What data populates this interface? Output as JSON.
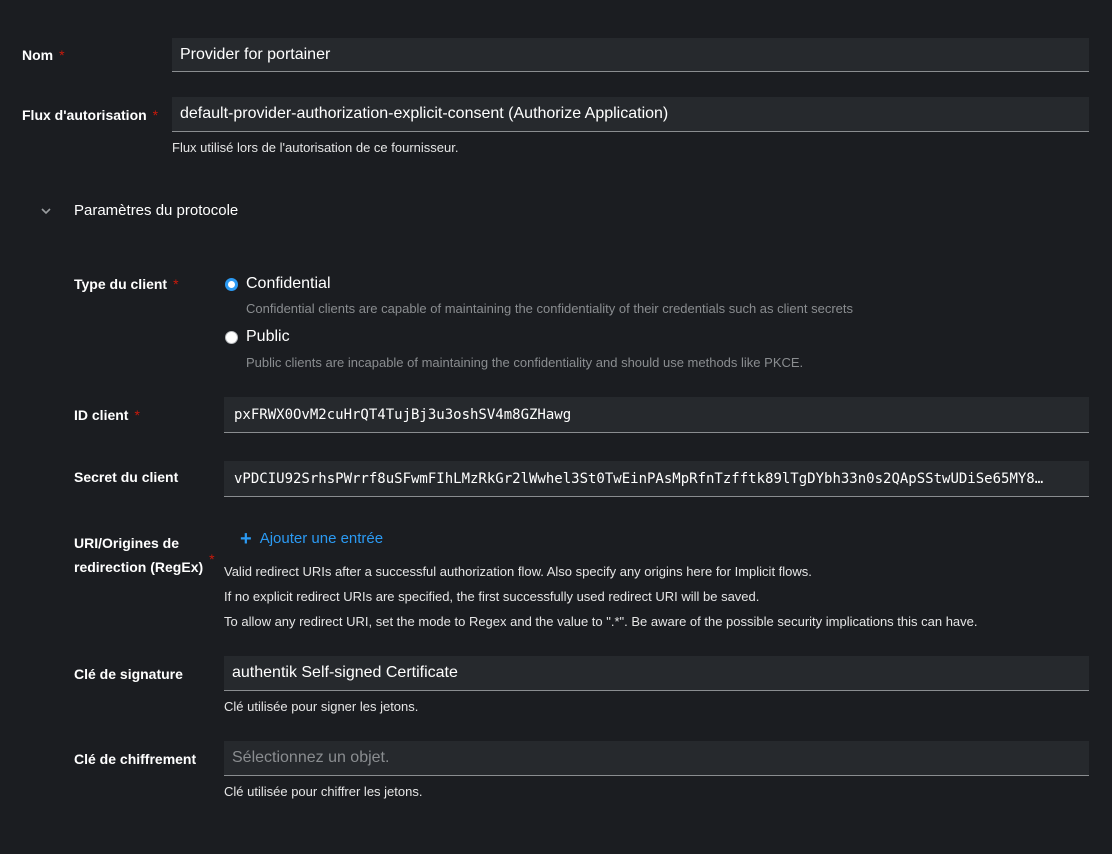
{
  "fields": {
    "name": {
      "label": "Nom",
      "required": "*",
      "value": "Provider for portainer"
    },
    "flow": {
      "label": "Flux d'autorisation",
      "required": "*",
      "value": "default-provider-authorization-explicit-consent (Authorize Application)",
      "help": "Flux utilisé lors de l'autorisation de ce fournisseur."
    }
  },
  "protocol": {
    "section_title": "Paramètres du protocole",
    "client_type": {
      "label": "Type du client",
      "required": "*",
      "options": [
        {
          "label": "Confidential",
          "description": "Confidential clients are capable of maintaining the confidentiality of their credentials such as client secrets",
          "checked": true
        },
        {
          "label": "Public",
          "description": "Public clients are incapable of maintaining the confidentiality and should use methods like PKCE.",
          "checked": false
        }
      ]
    },
    "client_id": {
      "label": "ID client",
      "required": "*",
      "value": "pxFRWX0OvM2cuHrQT4TujBj3u3oshSV4m8GZHawg"
    },
    "client_secret": {
      "label": "Secret du client",
      "value": "vPDCIU92SrhsPWrrf8uSFwmFIhLMzRkGr2lWwhel3St0TwEinPAsMpRfnTzfftk89lTgDYbh33n0s2QApSStwUDiSe65MY8…"
    },
    "redirect": {
      "label_line1": "URI/Origines de",
      "label_line2": "redirection (RegEx)",
      "required": "*",
      "add_label": "Ajouter une entrée",
      "help_lines": [
        "Valid redirect URIs after a successful authorization flow. Also specify any origins here for Implicit flows.",
        "If no explicit redirect URIs are specified, the first successfully used redirect URI will be saved.",
        "To allow any redirect URI, set the mode to Regex and the value to \".*\". Be aware of the possible security implications this can have."
      ]
    },
    "signing_key": {
      "label": "Clé de signature",
      "value": "authentik Self-signed Certificate",
      "help": "Clé utilisée pour signer les jetons."
    },
    "encryption_key": {
      "label": "Clé de chiffrement",
      "placeholder": "Sélectionnez un objet.",
      "help": "Clé utilisée pour chiffrer les jetons."
    }
  },
  "icons": {
    "collapse": "chevron-down-icon",
    "add": "plus-icon"
  },
  "colors": {
    "background": "#1b1d21",
    "input_bg": "#26292d",
    "accent": "#2b9af3",
    "required": "#c9190b"
  }
}
